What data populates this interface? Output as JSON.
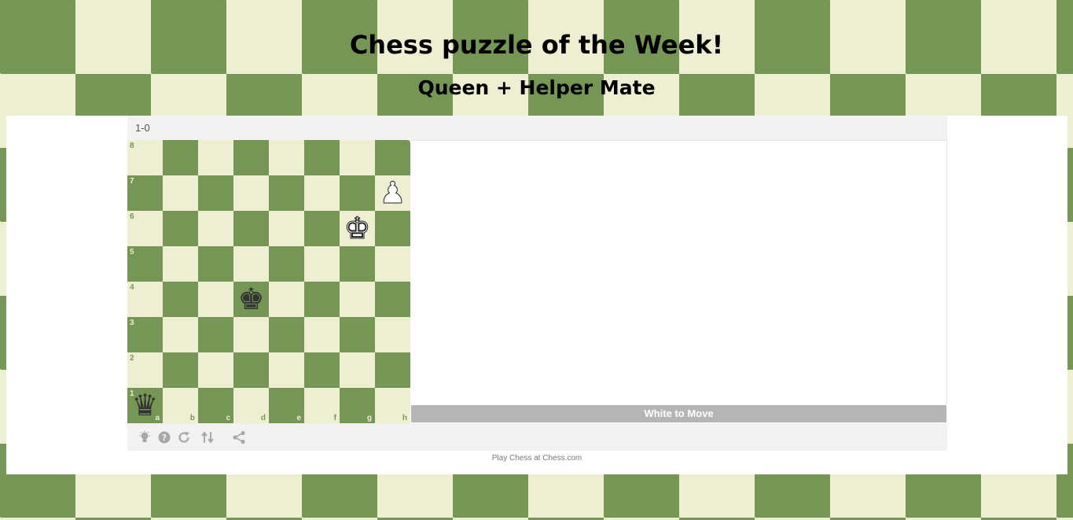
{
  "header": {
    "title": "Chess puzzle of the Week!",
    "subtitle": "Queen + Helper Mate"
  },
  "game": {
    "result": "1-0",
    "status": "White to Move",
    "files": [
      "a",
      "b",
      "c",
      "d",
      "e",
      "f",
      "g",
      "h"
    ],
    "ranks": [
      "8",
      "7",
      "6",
      "5",
      "4",
      "3",
      "2",
      "1"
    ],
    "pieces": [
      {
        "square": "h7",
        "color": "white",
        "type": "pawn",
        "glyph": "♟"
      },
      {
        "square": "g6",
        "color": "white",
        "type": "king",
        "glyph": "♚"
      },
      {
        "square": "d4",
        "color": "black",
        "type": "king",
        "glyph": "♚"
      },
      {
        "square": "a1",
        "color": "black",
        "type": "queen",
        "glyph": "♛"
      }
    ]
  },
  "toolbar": {
    "tools": [
      {
        "name": "hint-icon",
        "glyph": "💡"
      },
      {
        "name": "help-icon",
        "glyph": "?"
      },
      {
        "name": "reset-icon",
        "glyph": "⟳"
      },
      {
        "name": "flip-board-icon",
        "glyph": "⇅"
      },
      {
        "name": "share-icon",
        "glyph": "⋖"
      }
    ]
  },
  "footer": {
    "credit": "Play Chess at Chess.com"
  },
  "colors": {
    "light_square": "#eeeed2",
    "dark_square": "#769656",
    "status_bar": "#b5b5b5"
  }
}
